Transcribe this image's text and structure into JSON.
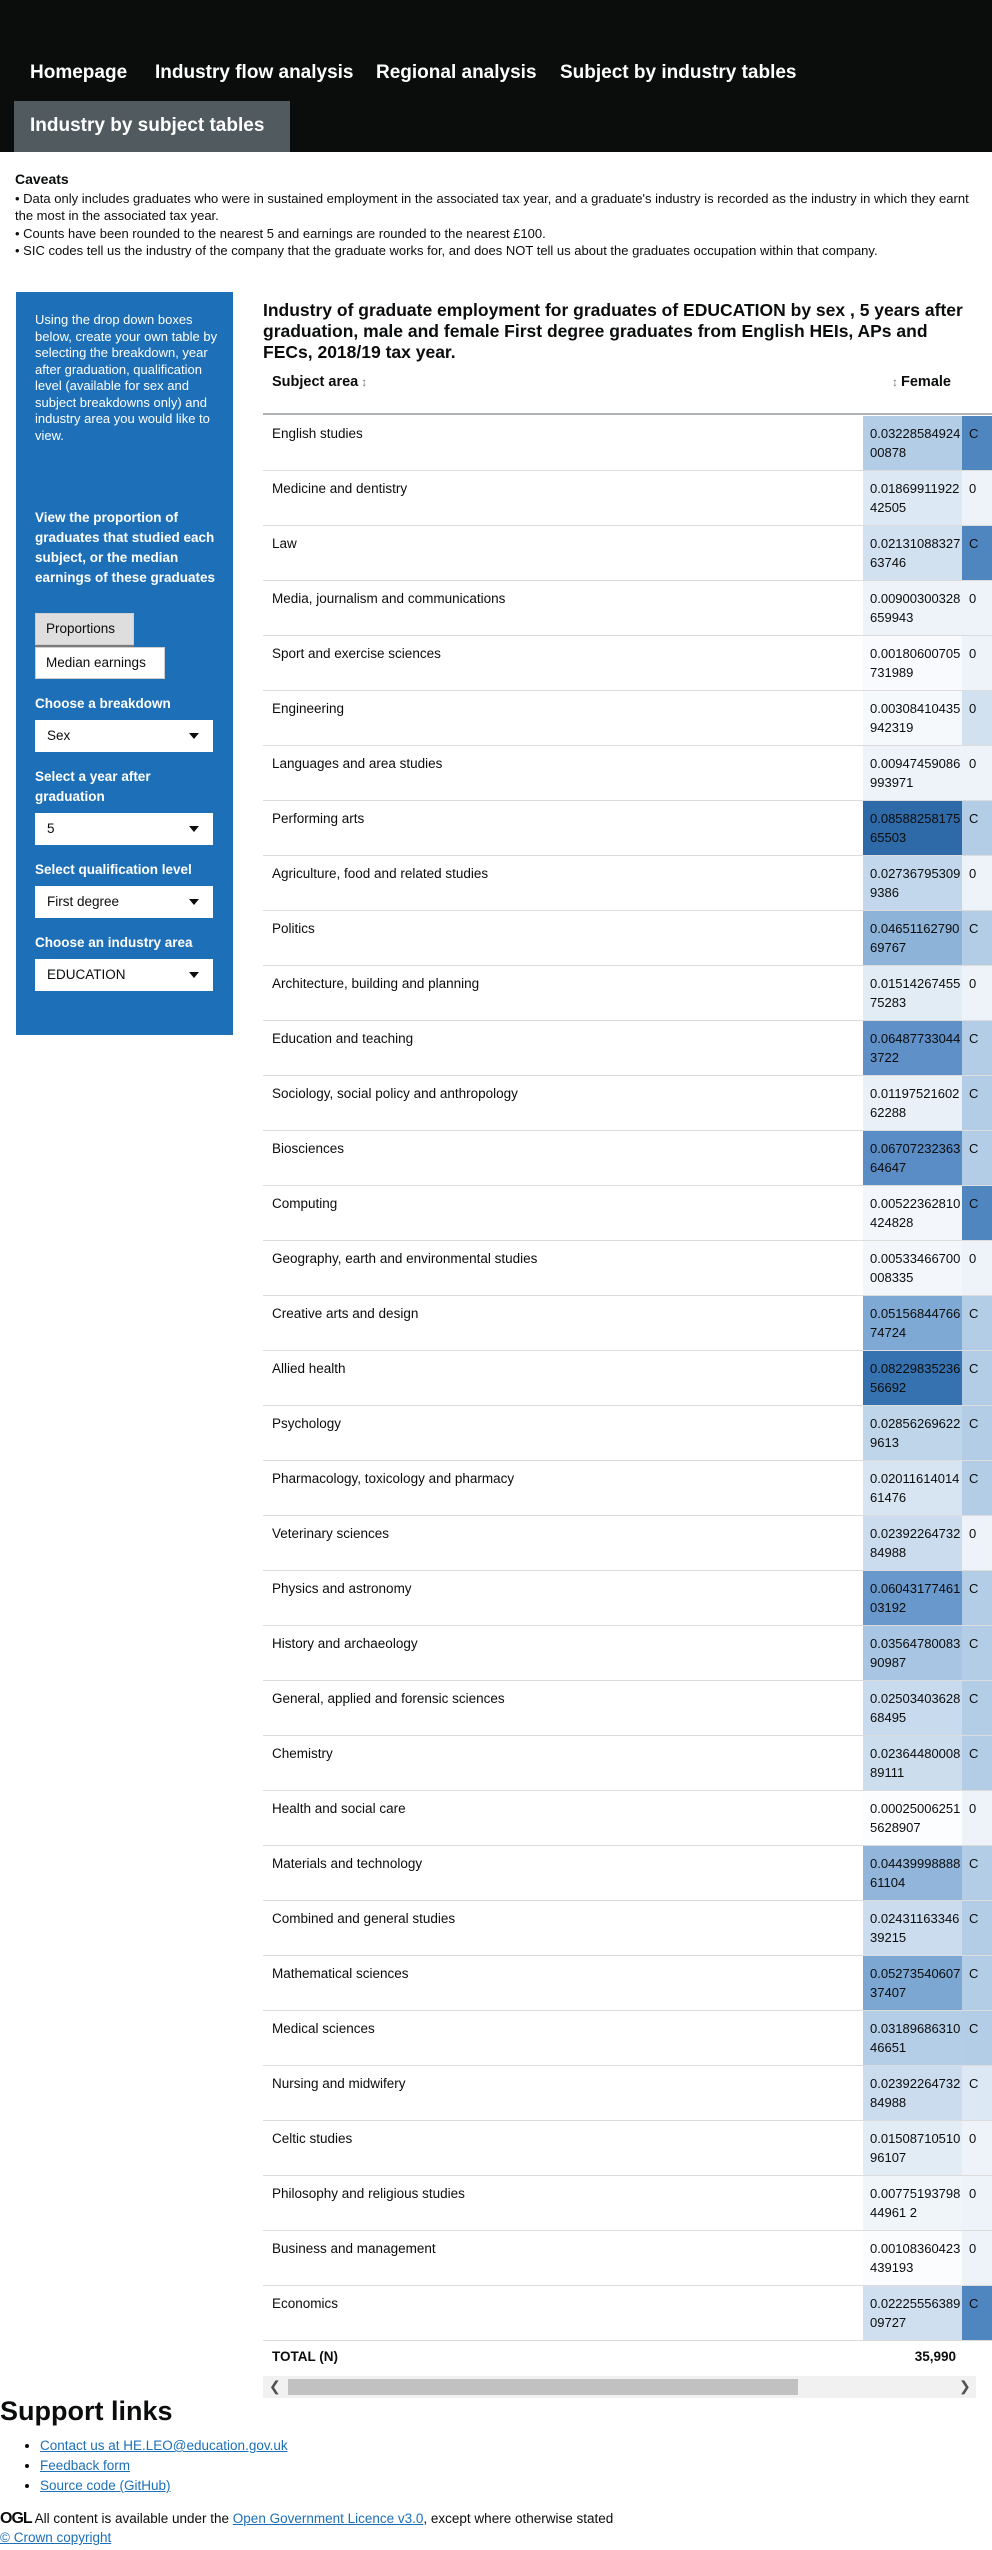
{
  "nav": {
    "items": [
      "Homepage",
      "Industry flow analysis",
      "Regional analysis",
      "Subject by industry tables"
    ],
    "active": "Industry by subject tables"
  },
  "caveats": {
    "title": "Caveats",
    "lines": [
      "• Data only includes graduates who were in sustained employment in the associated tax year, and a graduate's industry is recorded as the industry in which they earnt the most in the associated tax year.",
      "• Counts have been rounded to the nearest 5 and earnings are rounded to the nearest £100.",
      "• SIC codes tell us the industry of the company that the graduate works for, and does NOT tell us about the graduates occupation within that company."
    ]
  },
  "sidebar": {
    "intro": "Using the drop down boxes below, create your own table by selecting the breakdown, year after graduation, qualification level (available for sex and subject breakdowns only) and industry area you would like to view.",
    "proportion_heading": "View the proportion of graduates that studied each subject, or the median earnings of these graduates",
    "proportions_button": "Proportions",
    "earnings_button": "Median earnings",
    "breakdown_label": "Choose a breakdown",
    "breakdown_value": "Sex",
    "year_label": "Select a year after graduation",
    "year_value": "5",
    "qualification_label": "Select qualification level",
    "qualification_value": "First degree",
    "industry_label": "Choose an industry area",
    "industry_value": "EDUCATION"
  },
  "table": {
    "title": "Industry of graduate employment for graduates of EDUCATION by sex , 5 years after graduation, male and female First degree graduates from English HEIs, APs and FECs, 2018/19 tax year.",
    "col_subject": "Subject area",
    "col_female": "Female",
    "sort_glyph": "↕",
    "rows": [
      {
        "subject": "English studies",
        "female": "0.0322858492400878",
        "shade": "#b3cde6",
        "next": "C",
        "next_shade": "#4f86c0"
      },
      {
        "subject": "Medicine and dentistry",
        "female": "0.0186991192242505",
        "shade": "#dce8f3",
        "next": "0",
        "next_shade": "#eef3f9"
      },
      {
        "subject": "Law",
        "female": "0.0213108832763746",
        "shade": "#d2e1f0",
        "next": "C",
        "next_shade": "#4f86c0"
      },
      {
        "subject": "Media, journalism and communications",
        "female": "0.00900300328659943",
        "shade": "#eef3f9",
        "next": "0",
        "next_shade": "#eef3f9"
      },
      {
        "subject": "Sport and exercise sciences",
        "female": "0.00180600705731989",
        "shade": "#f8fafd",
        "next": "0",
        "next_shade": "#eef3f9"
      },
      {
        "subject": "Engineering",
        "female": "0.00308410435942319",
        "shade": "#f6f9fc",
        "next": "0",
        "next_shade": "#d2e1f0"
      },
      {
        "subject": "Languages and area studies",
        "female": "0.00947459086993971",
        "shade": "#edf3f9",
        "next": "0",
        "next_shade": "#eef3f9"
      },
      {
        "subject": "Performing arts",
        "female": "0.0858825817565503",
        "shade": "#2f6aa8",
        "next": "C",
        "next_shade": "#b3cde6"
      },
      {
        "subject": "Agriculture, food and related studies",
        "female": "0.027367953099386",
        "shade": "#c2d7eb",
        "next": "0",
        "next_shade": "#eef3f9"
      },
      {
        "subject": "Politics",
        "female": "0.0465116279069767",
        "shade": "#8db3d9",
        "next": "C",
        "next_shade": "#b3cde6"
      },
      {
        "subject": "Architecture, building and planning",
        "female": "0.0151426745575283",
        "shade": "#e2ecf5",
        "next": "0",
        "next_shade": "#eef3f9"
      },
      {
        "subject": "Education and teaching",
        "female": "0.064877330443722",
        "shade": "#5f91c8",
        "next": "C",
        "next_shade": "#b3cde6"
      },
      {
        "subject": "Sociology, social policy and anthropology",
        "female": "0.0119752160262288",
        "shade": "#e9f0f8",
        "next": "C",
        "next_shade": "#b3cde6"
      },
      {
        "subject": "Biosciences",
        "female": "0.0670723236364647",
        "shade": "#5a8dc5",
        "next": "C",
        "next_shade": "#b3cde6"
      },
      {
        "subject": "Computing",
        "female": "0.00522362810424828",
        "shade": "#f3f7fb",
        "next": "C",
        "next_shade": "#4f86c0"
      },
      {
        "subject": "Geography, earth and environmental studies",
        "female": "0.00533466700008335",
        "shade": "#f3f7fb",
        "next": "0",
        "next_shade": "#eef3f9"
      },
      {
        "subject": "Creative arts and design",
        "female": "0.0515684476674724",
        "shade": "#7ea9d4",
        "next": "C",
        "next_shade": "#b3cde6"
      },
      {
        "subject": "Allied health",
        "female": "0.0822983523656692",
        "shade": "#3672b0",
        "next": "C",
        "next_shade": "#b3cde6"
      },
      {
        "subject": "Psychology",
        "female": "0.028562696229613",
        "shade": "#bfd5ea",
        "next": "C",
        "next_shade": "#b3cde6"
      },
      {
        "subject": "Pharmacology, toxicology and pharmacy",
        "female": "0.0201161401461476",
        "shade": "#d7e5f2",
        "next": "C",
        "next_shade": "#b3cde6"
      },
      {
        "subject": "Veterinary sciences",
        "female": "0.0239226473284988",
        "shade": "#cbdcee",
        "next": "0",
        "next_shade": "#eef3f9"
      },
      {
        "subject": "Physics and astronomy",
        "female": "0.0604317746103192",
        "shade": "#6999cc",
        "next": "C",
        "next_shade": "#b3cde6"
      },
      {
        "subject": "History and archaeology",
        "female": "0.0356478008390987",
        "shade": "#a8c6e3",
        "next": "C",
        "next_shade": "#b3cde6"
      },
      {
        "subject": "General, applied and forensic sciences",
        "female": "0.0250340362868495",
        "shade": "#c8daed",
        "next": "C",
        "next_shade": "#b3cde6"
      },
      {
        "subject": "Chemistry",
        "female": "0.0236448000889111",
        "shade": "#ccddee",
        "next": "C",
        "next_shade": "#b3cde6"
      },
      {
        "subject": "Health and social care",
        "female": "0.000250062515628907",
        "shade": "#fcfdfe",
        "next": "0",
        "next_shade": "#eef3f9"
      },
      {
        "subject": "Materials and technology",
        "female": "0.0443999888861104",
        "shade": "#92b6db",
        "next": "C",
        "next_shade": "#b3cde6"
      },
      {
        "subject": "Combined and general studies",
        "female": "0.0243116334639215",
        "shade": "#cadcee",
        "next": "C",
        "next_shade": "#b3cde6"
      },
      {
        "subject": "Mathematical sciences",
        "female": "0.0527354060737407",
        "shade": "#7ba7d2",
        "next": "C",
        "next_shade": "#b3cde6"
      },
      {
        "subject": "Medical sciences",
        "female": "0.0318968631046651",
        "shade": "#b4cee7",
        "next": "C",
        "next_shade": "#b3cde6"
      },
      {
        "subject": "Nursing and midwifery",
        "female": "0.0239226473284988",
        "shade": "#cbdcee",
        "next": "C",
        "next_shade": "#dce8f3"
      },
      {
        "subject": "Celtic studies",
        "female": "0.0150871051096107",
        "shade": "#e2ecf5",
        "next": "0",
        "next_shade": "#eef3f9"
      },
      {
        "subject": "Philosophy and religious studies",
        "female": "0.0077519379844961 2",
        "shade": "#f0f5fa",
        "next": "0",
        "next_shade": "#eef3f9"
      },
      {
        "subject": "Business and management",
        "female": "0.00108360423439193",
        "shade": "#fafcfe",
        "next": "0",
        "next_shade": "#eef3f9"
      },
      {
        "subject": "Economics",
        "female": "0.0222555638909727",
        "shade": "#cfdfef",
        "next": "C",
        "next_shade": "#4f86c0"
      }
    ],
    "total_label": "TOTAL (N)",
    "total_female": "35,990"
  },
  "scrollbar": {
    "left_arrow": "❮",
    "right_arrow": "❯"
  },
  "support": {
    "heading": "Support links",
    "links": [
      "Contact us at HE.LEO@education.gov.uk",
      "Feedback form",
      "Source code (GitHub)"
    ]
  },
  "footer": {
    "ogl": "OGL",
    "licence_prefix": "All content is available under the ",
    "licence_link": "Open Government Licence v3.0",
    "licence_suffix": ", except where otherwise stated",
    "crown": "© Crown copyright"
  }
}
